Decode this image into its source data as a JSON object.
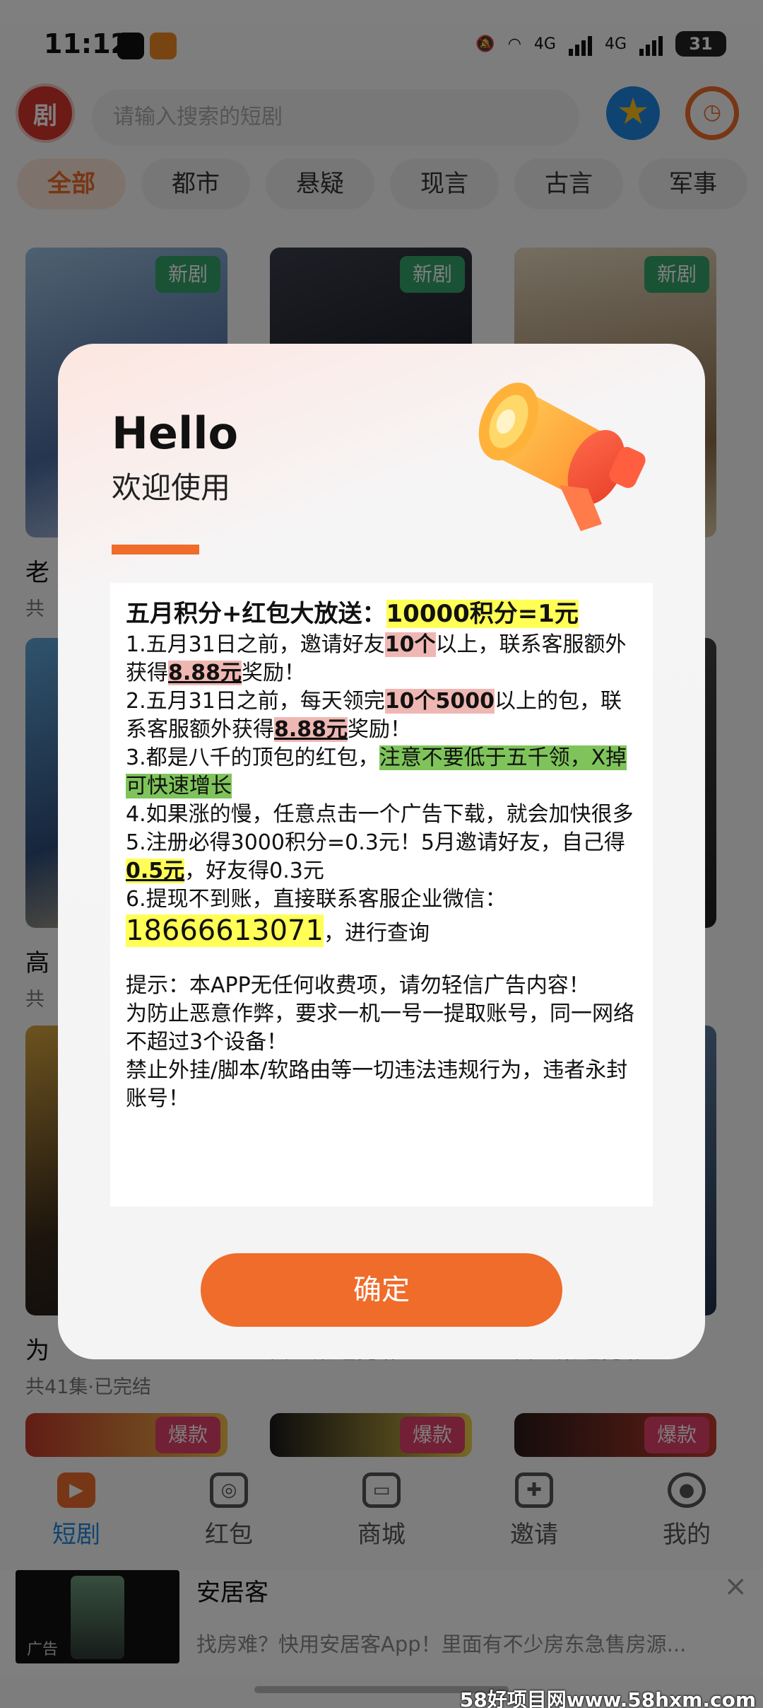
{
  "status_bar": {
    "time": "11:12",
    "network_1": "4G",
    "network_2": "4G",
    "battery": "31"
  },
  "header": {
    "logo_text": "剧",
    "search_placeholder": "请输入搜索的短剧"
  },
  "categories": [
    "全部",
    "都市",
    "悬疑",
    "现言",
    "古言",
    "军事"
  ],
  "cards": [
    {
      "badge": "新剧",
      "title": "老",
      "meta": "共"
    },
    {
      "badge": "新剧",
      "title": "",
      "meta": ""
    },
    {
      "badge": "新剧",
      "title": "",
      "meta": ""
    },
    {
      "badge": "",
      "title": "高",
      "meta": "共"
    },
    {
      "badge": "",
      "title": "为",
      "meta": "共41集·已完结"
    },
    {
      "badge": "",
      "title": "",
      "meta": "共44集·已完结"
    },
    {
      "badge": "",
      "title": "",
      "meta": "共60集·已完结"
    },
    {
      "badge": "爆款",
      "title": "",
      "meta": ""
    },
    {
      "badge": "爆款",
      "title": "",
      "meta": ""
    },
    {
      "badge": "爆款",
      "title": "",
      "meta": ""
    }
  ],
  "tabbar": {
    "items": [
      {
        "label": "短剧",
        "icon": "play-icon"
      },
      {
        "label": "红包",
        "icon": "red-packet-icon"
      },
      {
        "label": "商城",
        "icon": "tv-icon"
      },
      {
        "label": "邀请",
        "icon": "invite-icon"
      },
      {
        "label": "我的",
        "icon": "person-icon"
      }
    ]
  },
  "ad": {
    "title": "安居客",
    "description": "找房难？快用安居客App！里面有不少房东急售房源...",
    "tag": "广告",
    "close": "×"
  },
  "watermark": "58好项目网www.58hxm.com",
  "dialog": {
    "hello": "Hello",
    "welcome": "欢迎使用",
    "headline_prefix": "五月积分+红包大放送：",
    "headline_highlight": "10000积分=1元",
    "item1": {
      "a": "1.五月31日之前，邀请好友",
      "b": "10个",
      "c": "以上，联系客服额外获得",
      "d": "8.88元",
      "e": "奖励！"
    },
    "item2": {
      "a": "2.五月31日之前，每天领完",
      "b": "10个5000",
      "c": "以上的包，联系客服额外获得",
      "d": "8.88元",
      "e": "奖励！"
    },
    "item3": {
      "a": "3.都是八千的顶包的红包，",
      "b": "注意不要低于五千领，X掉可快速增长"
    },
    "item4": "4.如果涨的慢，任意点击一个广告下载，就会加快很多",
    "item5": {
      "a": "5.注册必得3000积分=0.3元！5月邀请好友，自己得",
      "b": "0.5元",
      "c": "，好友得0.3元"
    },
    "item6": {
      "a": "6.提现不到账，直接联系客服企业微信：",
      "phone": "18666613071",
      "c": "，进行查询"
    },
    "tip1": "提示：本APP无任何收费项，请勿轻信广告内容！",
    "tip2": "为防止恶意作弊，要求一机一号一提取账号，同一网络不超过3个设备！",
    "tip3": "禁止外挂/脚本/软路由等一切违法违规行为，违者永封账号！",
    "confirm_label": "确定"
  },
  "colors": {
    "accent": "#ef6c2a",
    "tab_active": "#1e88e5",
    "badge_new": "#34a56a",
    "badge_hot": "#e5416c"
  }
}
